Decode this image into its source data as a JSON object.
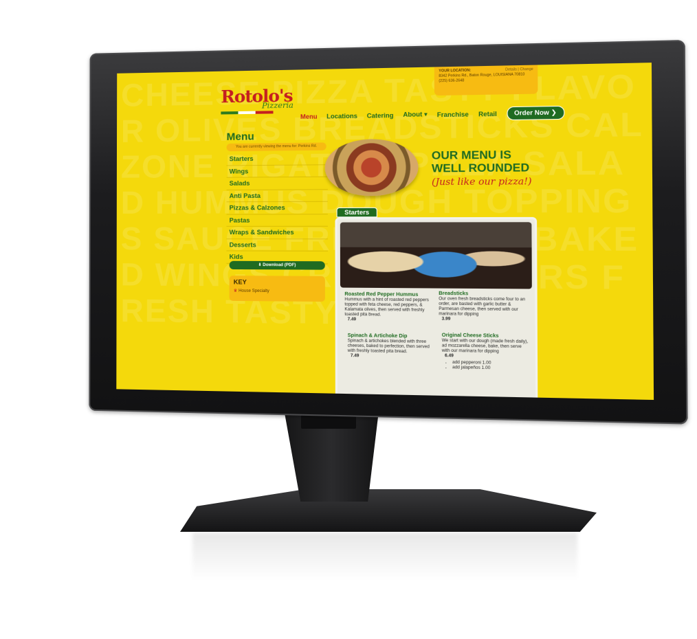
{
  "site": {
    "logo_main": "Rotolo's",
    "logo_sub": "Pizzeria",
    "background_words": "CHEESE PIZZA TASTY FLAVOR OLIVES BREADSTICKS CALZONE RIGATONI PIZZA SALAD HUMMUS DOUGH TOPPINGS SAUCE FRESH PIZZA BAKED WINGS CRUST PEPPERS FRESH TASTY"
  },
  "location": {
    "label": "YOUR LOCATION:",
    "address": "8342 Perkins Rd., Baton Rouge, LOUISIANA 70810",
    "phone": "(225) 636-2648",
    "details_change": "Details | Change"
  },
  "nav": {
    "items": [
      "Menu",
      "Locations",
      "Catering",
      "About ▾",
      "Franchise",
      "Retail"
    ],
    "order_now": "Order Now ❯"
  },
  "sidebar": {
    "title": "Menu",
    "viewing_note": "You are currently viewing the menu for: Perkins Rd.",
    "items": [
      "Starters",
      "Wings",
      "Salads",
      "Anti Pasta",
      "Pizzas & Calzones",
      "Pastas",
      "Wraps & Sandwiches",
      "Desserts",
      "Kids"
    ],
    "download": "⬇ Download (PDF)",
    "key_title": "KEY",
    "key_item": "House Specialty"
  },
  "hero": {
    "line1": "OUR MENU IS",
    "line2": "WELL ROUNDED",
    "line3": "(Just like our pizza!)"
  },
  "section": {
    "title": "Starters",
    "dishes": [
      {
        "name": "Roasted Red Pepper Hummus",
        "desc": "Hummus with a hint of roasted red peppers topped with feta cheese, red peppers, & Kalamata olives, then served with freshly toasted pita bread.",
        "price": "7.49"
      },
      {
        "name": "Breadsticks",
        "desc": "Our oven fresh breadsticks come four to an order, are basted with garlic butter & Parmesan cheese, then served with our marinara for dipping",
        "price": "3.99"
      },
      {
        "name": "Spinach & Artichoke Dip",
        "desc": "Spinach & artichokes blended with three cheeses, baked to perfection, then served with freshly toasted pita bread.",
        "price": "7.49"
      },
      {
        "name": "Original Cheese Sticks",
        "desc": "We start with our dough (made fresh daily), ad mozzarella cheese, bake, then serve with our marinara for dipping",
        "price": "6.49",
        "addons": [
          "add pepperoni 1.00",
          "add jalapeños 1.00"
        ]
      }
    ]
  },
  "colors": {
    "background": "#f4d90c",
    "brand_green": "#1f6b21",
    "brand_red": "#c41f20",
    "accent_orange": "#f7bb12"
  }
}
